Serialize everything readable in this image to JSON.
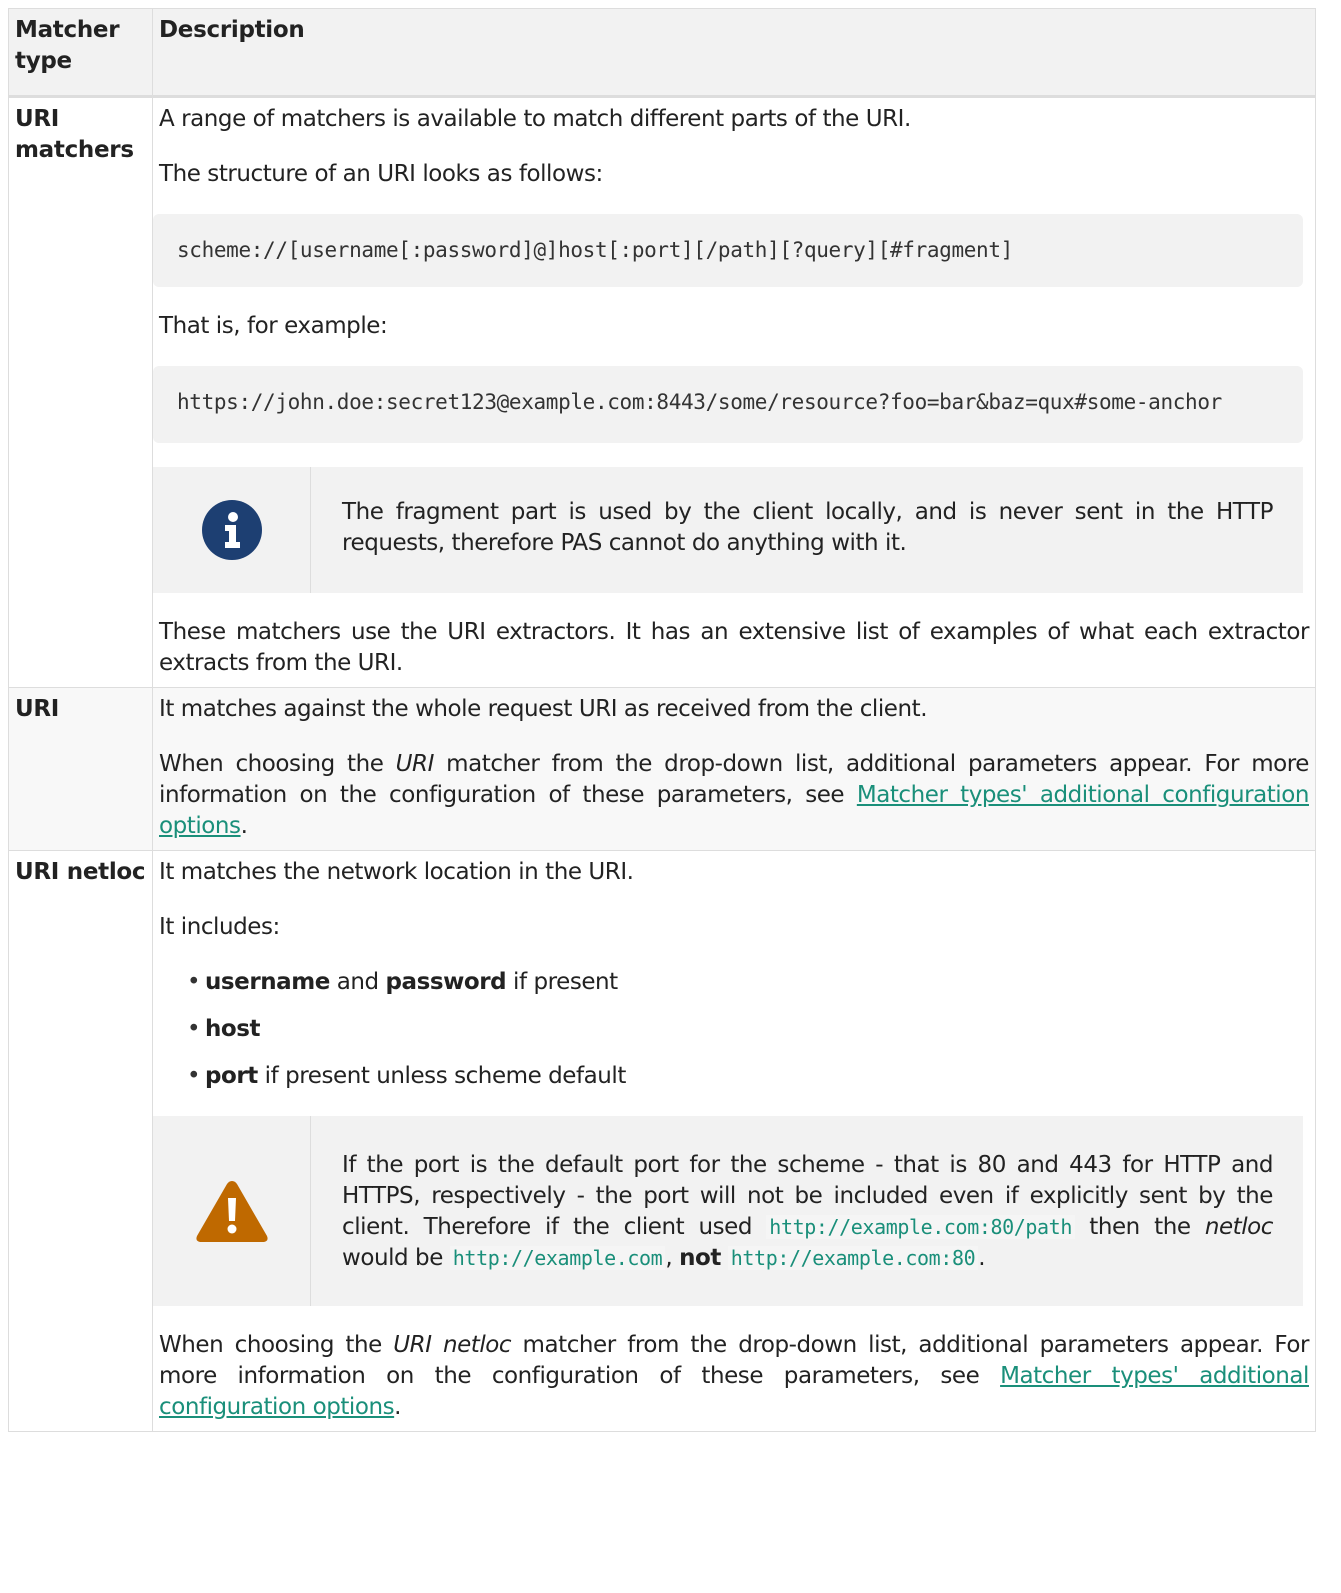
{
  "header": {
    "col1": "Matcher type",
    "col2": "Description"
  },
  "rows": {
    "uri_matchers": {
      "type": "URI matchers",
      "p1": "A range of matchers is available to match different parts of the URI.",
      "p2": "The structure of an URI looks as follows:",
      "code1": "scheme://[username[:password]@]host[:port][/path][?query][#fragment]",
      "p3": "That is, for example:",
      "code2": "https://john.doe:secret123@example.com:8443/some/resource?foo=bar&baz=qux#some-anchor",
      "note": "The fragment part is used by the client locally, and is never sent in the HTTP requests, therefore PAS cannot do anything with it.",
      "p4": "These matchers use the URI extractors. It has an extensive list of examples of what each extractor extracts from the URI."
    },
    "uri": {
      "type": "URI",
      "p1": "It matches against the whole request URI as received from the client.",
      "p2_a": "When choosing the ",
      "p2_em": "URI",
      "p2_b": " matcher from the drop-down list, additional parameters appear. For more information on the configuration of these parameters, see ",
      "p2_link": "Matcher types' additional configuration options",
      "p2_c": "."
    },
    "uri_netloc": {
      "type": "URI netloc",
      "p1": "It matches the network location in the URI.",
      "p2": "It includes:",
      "li1_b1": "username",
      "li1_t1": " and ",
      "li1_b2": "password",
      "li1_t2": " if present",
      "li2_b": "host",
      "li3_b": "port",
      "li3_t": " if present unless scheme default",
      "warn_a": "If the port is the default port for the scheme - that is 80 and 443 for HTTP and HTTPS, respectively - the port will not be included even if explicitly sent by the client. Therefore if the client used ",
      "warn_code1": "http://example.com:80/path",
      "warn_b": " then the ",
      "warn_em": "netloc",
      "warn_c": " would be ",
      "warn_code2": "http://example.com",
      "warn_d": ", ",
      "warn_strong": "not",
      "warn_e": " ",
      "warn_code3": "http://example.com:80",
      "warn_f": ".",
      "p3_a": "When choosing the ",
      "p3_em": "URI netloc",
      "p3_b": " matcher from the drop-down list, additional parameters appear. For more information on the configuration of these parameters, see ",
      "p3_link": "Matcher types' additional configuration options",
      "p3_c": "."
    }
  },
  "colors": {
    "note_icon": "#1d3f72",
    "warn_icon": "#bf6900",
    "link": "#1a8f7a"
  }
}
